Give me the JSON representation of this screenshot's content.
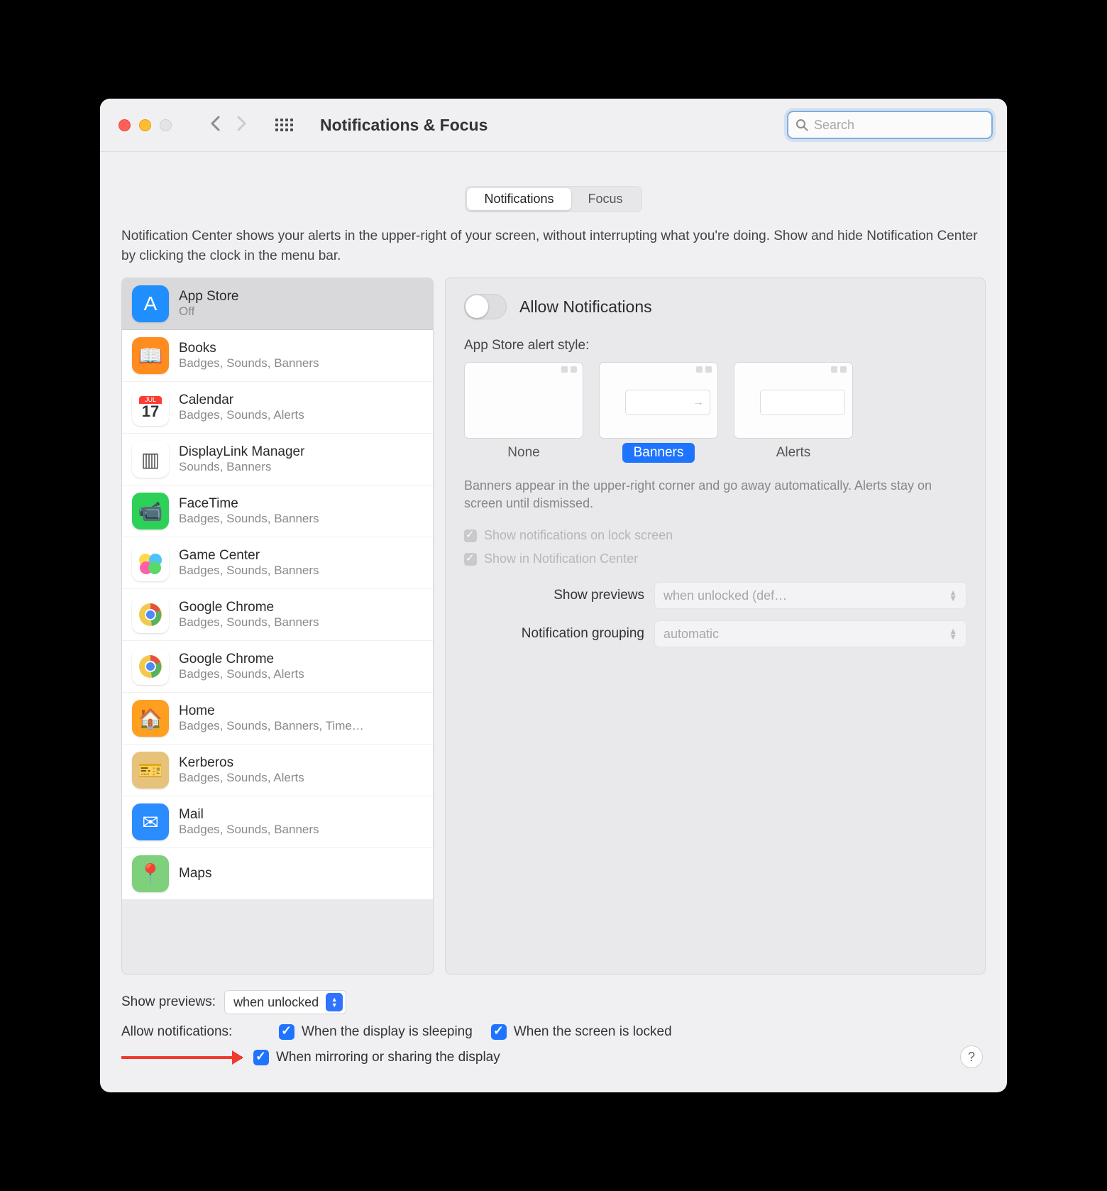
{
  "toolbar": {
    "title": "Notifications & Focus",
    "search_placeholder": "Search"
  },
  "tabs": {
    "notifications": "Notifications",
    "focus": "Focus"
  },
  "description": "Notification Center shows your alerts in the upper-right of your screen, without interrupting what you're doing. Show and hide Notification Center by clicking the clock in the menu bar.",
  "apps": [
    {
      "name": "App Store",
      "sub": "Off",
      "bg": "#1f8fff",
      "glyph": "A"
    },
    {
      "name": "Books",
      "sub": "Badges, Sounds, Banners",
      "bg": "#ff8c1f",
      "glyph": "📖"
    },
    {
      "name": "Calendar",
      "sub": "Badges, Sounds, Alerts",
      "bg": "#ffffff",
      "glyph": "17"
    },
    {
      "name": "DisplayLink Manager",
      "sub": "Sounds, Banners",
      "bg": "#ffffff",
      "glyph": "▥"
    },
    {
      "name": "FaceTime",
      "sub": "Badges, Sounds, Banners",
      "bg": "#2ed158",
      "glyph": "📹"
    },
    {
      "name": "Game Center",
      "sub": "Badges, Sounds, Banners",
      "bg": "#ffffff",
      "glyph": "●"
    },
    {
      "name": "Google Chrome",
      "sub": "Badges, Sounds, Banners",
      "bg": "#ffffff",
      "glyph": "◎"
    },
    {
      "name": "Google Chrome",
      "sub": "Badges, Sounds, Alerts",
      "bg": "#ffffff",
      "glyph": "◎"
    },
    {
      "name": "Home",
      "sub": "Badges, Sounds, Banners, Time…",
      "bg": "#ff9f1f",
      "glyph": "🏠"
    },
    {
      "name": "Kerberos",
      "sub": "Badges, Sounds, Alerts",
      "bg": "#e6c27a",
      "glyph": "🎫"
    },
    {
      "name": "Mail",
      "sub": "Badges, Sounds, Banners",
      "bg": "#2a8cff",
      "glyph": "✉"
    },
    {
      "name": "Maps",
      "sub": "",
      "bg": "#7ed07a",
      "glyph": "📍"
    }
  ],
  "details": {
    "allow_label": "Allow Notifications",
    "alert_style_title": "App Store alert style:",
    "styles": {
      "none": "None",
      "banners": "Banners",
      "alerts": "Alerts"
    },
    "style_desc": "Banners appear in the upper-right corner and go away automatically. Alerts stay on screen until dismissed.",
    "lock_screen": "Show notifications on lock screen",
    "notif_center": "Show in Notification Center",
    "previews_label": "Show previews",
    "previews_value": "when unlocked (def…",
    "grouping_label": "Notification grouping",
    "grouping_value": "automatic"
  },
  "bottom": {
    "previews_label": "Show previews:",
    "previews_value": "when unlocked",
    "allow_label": "Allow notifications:",
    "sleeping": "When the display is sleeping",
    "locked": "When the screen is locked",
    "mirroring": "When mirroring or sharing the display"
  }
}
